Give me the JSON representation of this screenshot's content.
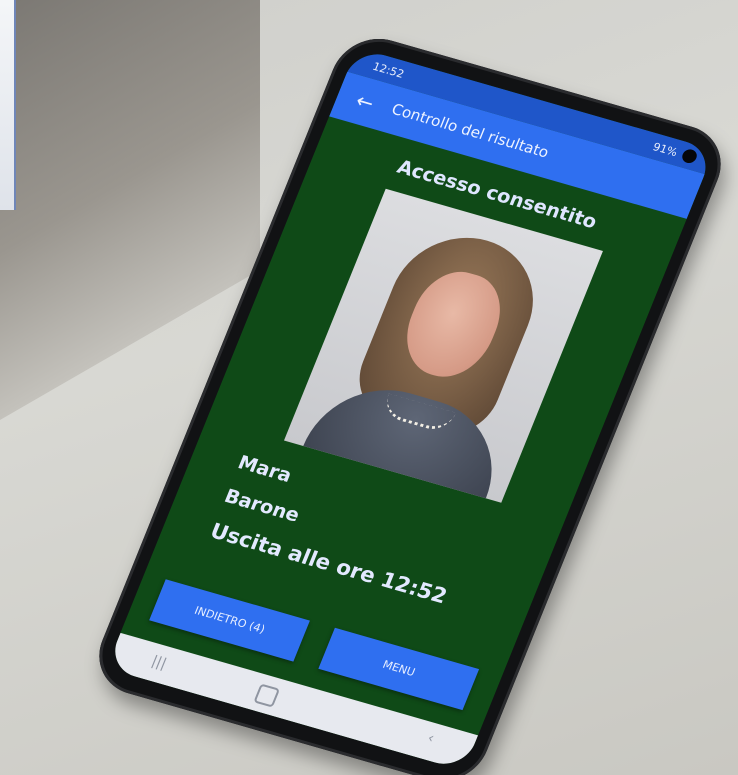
{
  "statusbar": {
    "time": "12:52",
    "signal": "91%"
  },
  "appbar": {
    "back_icon": "arrow-left-icon",
    "title": "Controllo del risultato"
  },
  "result": {
    "title": "Accesso consentito"
  },
  "person": {
    "first_name": "Mara",
    "last_name": "Barone",
    "exit_time": "Uscita alle ore 12:52"
  },
  "buttons": {
    "back_label": "INDIETRO (4)",
    "menu_label": "MENU"
  },
  "colors": {
    "screen_bg": "#0f4a17",
    "appbar": "#2f6ff0",
    "statusbar": "#1f56c9"
  }
}
